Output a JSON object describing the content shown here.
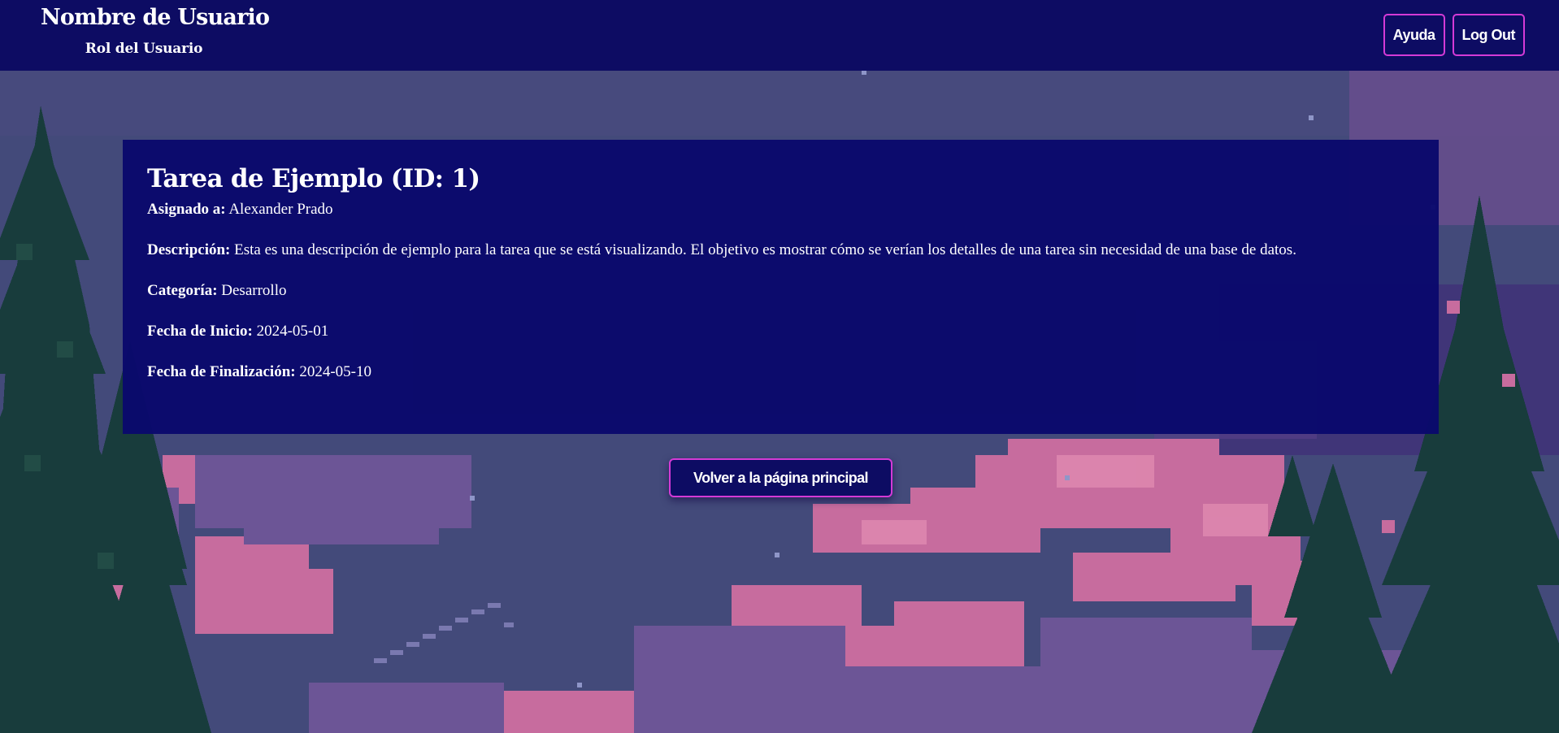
{
  "header": {
    "user_name": "Nombre de Usuario",
    "user_role": "Rol del Usuario",
    "help_label": "Ayuda",
    "logout_label": "Log Out"
  },
  "task": {
    "title": "Tarea de Ejemplo (ID: 1)",
    "fields": [
      {
        "label": "Asignado a:",
        "value": "Alexander Prado"
      },
      {
        "label": "Descripción:",
        "value": "Esta es una descripción de ejemplo para la tarea que se está visualizando. El objetivo es mostrar cómo se verían los detalles de una tarea sin necesidad de una base de datos."
      },
      {
        "label": "Categoría:",
        "value": "Desarrollo"
      },
      {
        "label": "Fecha de Inicio:",
        "value": "2024-05-01"
      },
      {
        "label": "Fecha de Finalización:",
        "value": "2024-05-10"
      }
    ]
  },
  "actions": {
    "back_label": "Volver a la página principal"
  },
  "colors": {
    "navy": "#0d0c63",
    "accent_border": "#d43ad6",
    "sky": "#434a7a",
    "cloud_pink": "#c76c9e",
    "cloud_purple": "#6c5596",
    "tree_green": "#183c3c"
  },
  "background": {
    "description_icons": [
      "night-sky",
      "pink-clouds",
      "pine-trees"
    ]
  }
}
